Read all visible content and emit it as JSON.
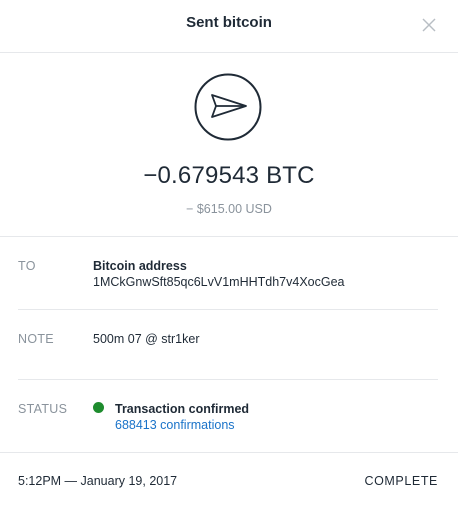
{
  "header": {
    "title": "Sent bitcoin",
    "close_icon": "close-icon"
  },
  "summary": {
    "icon": "paper-plane-icon",
    "amount": "−0.679543 BTC",
    "amount_usd": "− $615.00 USD"
  },
  "details": {
    "to": {
      "label": "TO",
      "title": "Bitcoin address",
      "address": "1MCkGnwSft85qc6LvV1mHHTdh7v4XocGea"
    },
    "note": {
      "label": "NOTE",
      "text": "500m 07 @ str1ker"
    },
    "status": {
      "label": "STATUS",
      "text": "Transaction confirmed",
      "confirmations": "688413 confirmations",
      "status_color": "#1e8c2e"
    }
  },
  "footer": {
    "datetime": "5:12PM — January 19, 2017",
    "status": "COMPLETE"
  },
  "colors": {
    "text": "#1f2a36",
    "muted": "#8a939c",
    "link": "#1a73c9",
    "divider": "#e6e8eb"
  }
}
